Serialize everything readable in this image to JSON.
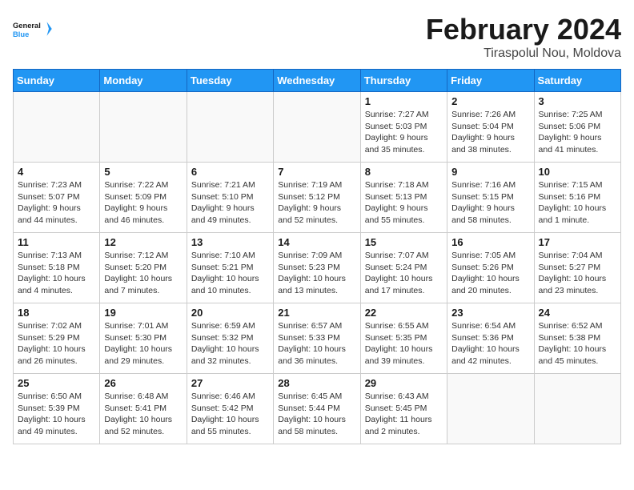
{
  "logo": {
    "general": "General",
    "blue": "Blue"
  },
  "title": "February 2024",
  "subtitle": "Tiraspolul Nou, Moldova",
  "weekdays": [
    "Sunday",
    "Monday",
    "Tuesday",
    "Wednesday",
    "Thursday",
    "Friday",
    "Saturday"
  ],
  "weeks": [
    [
      {
        "day": "",
        "sunrise": "",
        "sunset": "",
        "daylight": ""
      },
      {
        "day": "",
        "sunrise": "",
        "sunset": "",
        "daylight": ""
      },
      {
        "day": "",
        "sunrise": "",
        "sunset": "",
        "daylight": ""
      },
      {
        "day": "",
        "sunrise": "",
        "sunset": "",
        "daylight": ""
      },
      {
        "day": "1",
        "sunrise": "Sunrise: 7:27 AM",
        "sunset": "Sunset: 5:03 PM",
        "daylight": "Daylight: 9 hours and 35 minutes."
      },
      {
        "day": "2",
        "sunrise": "Sunrise: 7:26 AM",
        "sunset": "Sunset: 5:04 PM",
        "daylight": "Daylight: 9 hours and 38 minutes."
      },
      {
        "day": "3",
        "sunrise": "Sunrise: 7:25 AM",
        "sunset": "Sunset: 5:06 PM",
        "daylight": "Daylight: 9 hours and 41 minutes."
      }
    ],
    [
      {
        "day": "4",
        "sunrise": "Sunrise: 7:23 AM",
        "sunset": "Sunset: 5:07 PM",
        "daylight": "Daylight: 9 hours and 44 minutes."
      },
      {
        "day": "5",
        "sunrise": "Sunrise: 7:22 AM",
        "sunset": "Sunset: 5:09 PM",
        "daylight": "Daylight: 9 hours and 46 minutes."
      },
      {
        "day": "6",
        "sunrise": "Sunrise: 7:21 AM",
        "sunset": "Sunset: 5:10 PM",
        "daylight": "Daylight: 9 hours and 49 minutes."
      },
      {
        "day": "7",
        "sunrise": "Sunrise: 7:19 AM",
        "sunset": "Sunset: 5:12 PM",
        "daylight": "Daylight: 9 hours and 52 minutes."
      },
      {
        "day": "8",
        "sunrise": "Sunrise: 7:18 AM",
        "sunset": "Sunset: 5:13 PM",
        "daylight": "Daylight: 9 hours and 55 minutes."
      },
      {
        "day": "9",
        "sunrise": "Sunrise: 7:16 AM",
        "sunset": "Sunset: 5:15 PM",
        "daylight": "Daylight: 9 hours and 58 minutes."
      },
      {
        "day": "10",
        "sunrise": "Sunrise: 7:15 AM",
        "sunset": "Sunset: 5:16 PM",
        "daylight": "Daylight: 10 hours and 1 minute."
      }
    ],
    [
      {
        "day": "11",
        "sunrise": "Sunrise: 7:13 AM",
        "sunset": "Sunset: 5:18 PM",
        "daylight": "Daylight: 10 hours and 4 minutes."
      },
      {
        "day": "12",
        "sunrise": "Sunrise: 7:12 AM",
        "sunset": "Sunset: 5:20 PM",
        "daylight": "Daylight: 10 hours and 7 minutes."
      },
      {
        "day": "13",
        "sunrise": "Sunrise: 7:10 AM",
        "sunset": "Sunset: 5:21 PM",
        "daylight": "Daylight: 10 hours and 10 minutes."
      },
      {
        "day": "14",
        "sunrise": "Sunrise: 7:09 AM",
        "sunset": "Sunset: 5:23 PM",
        "daylight": "Daylight: 10 hours and 13 minutes."
      },
      {
        "day": "15",
        "sunrise": "Sunrise: 7:07 AM",
        "sunset": "Sunset: 5:24 PM",
        "daylight": "Daylight: 10 hours and 17 minutes."
      },
      {
        "day": "16",
        "sunrise": "Sunrise: 7:05 AM",
        "sunset": "Sunset: 5:26 PM",
        "daylight": "Daylight: 10 hours and 20 minutes."
      },
      {
        "day": "17",
        "sunrise": "Sunrise: 7:04 AM",
        "sunset": "Sunset: 5:27 PM",
        "daylight": "Daylight: 10 hours and 23 minutes."
      }
    ],
    [
      {
        "day": "18",
        "sunrise": "Sunrise: 7:02 AM",
        "sunset": "Sunset: 5:29 PM",
        "daylight": "Daylight: 10 hours and 26 minutes."
      },
      {
        "day": "19",
        "sunrise": "Sunrise: 7:01 AM",
        "sunset": "Sunset: 5:30 PM",
        "daylight": "Daylight: 10 hours and 29 minutes."
      },
      {
        "day": "20",
        "sunrise": "Sunrise: 6:59 AM",
        "sunset": "Sunset: 5:32 PM",
        "daylight": "Daylight: 10 hours and 32 minutes."
      },
      {
        "day": "21",
        "sunrise": "Sunrise: 6:57 AM",
        "sunset": "Sunset: 5:33 PM",
        "daylight": "Daylight: 10 hours and 36 minutes."
      },
      {
        "day": "22",
        "sunrise": "Sunrise: 6:55 AM",
        "sunset": "Sunset: 5:35 PM",
        "daylight": "Daylight: 10 hours and 39 minutes."
      },
      {
        "day": "23",
        "sunrise": "Sunrise: 6:54 AM",
        "sunset": "Sunset: 5:36 PM",
        "daylight": "Daylight: 10 hours and 42 minutes."
      },
      {
        "day": "24",
        "sunrise": "Sunrise: 6:52 AM",
        "sunset": "Sunset: 5:38 PM",
        "daylight": "Daylight: 10 hours and 45 minutes."
      }
    ],
    [
      {
        "day": "25",
        "sunrise": "Sunrise: 6:50 AM",
        "sunset": "Sunset: 5:39 PM",
        "daylight": "Daylight: 10 hours and 49 minutes."
      },
      {
        "day": "26",
        "sunrise": "Sunrise: 6:48 AM",
        "sunset": "Sunset: 5:41 PM",
        "daylight": "Daylight: 10 hours and 52 minutes."
      },
      {
        "day": "27",
        "sunrise": "Sunrise: 6:46 AM",
        "sunset": "Sunset: 5:42 PM",
        "daylight": "Daylight: 10 hours and 55 minutes."
      },
      {
        "day": "28",
        "sunrise": "Sunrise: 6:45 AM",
        "sunset": "Sunset: 5:44 PM",
        "daylight": "Daylight: 10 hours and 58 minutes."
      },
      {
        "day": "29",
        "sunrise": "Sunrise: 6:43 AM",
        "sunset": "Sunset: 5:45 PM",
        "daylight": "Daylight: 11 hours and 2 minutes."
      },
      {
        "day": "",
        "sunrise": "",
        "sunset": "",
        "daylight": ""
      },
      {
        "day": "",
        "sunrise": "",
        "sunset": "",
        "daylight": ""
      }
    ]
  ]
}
